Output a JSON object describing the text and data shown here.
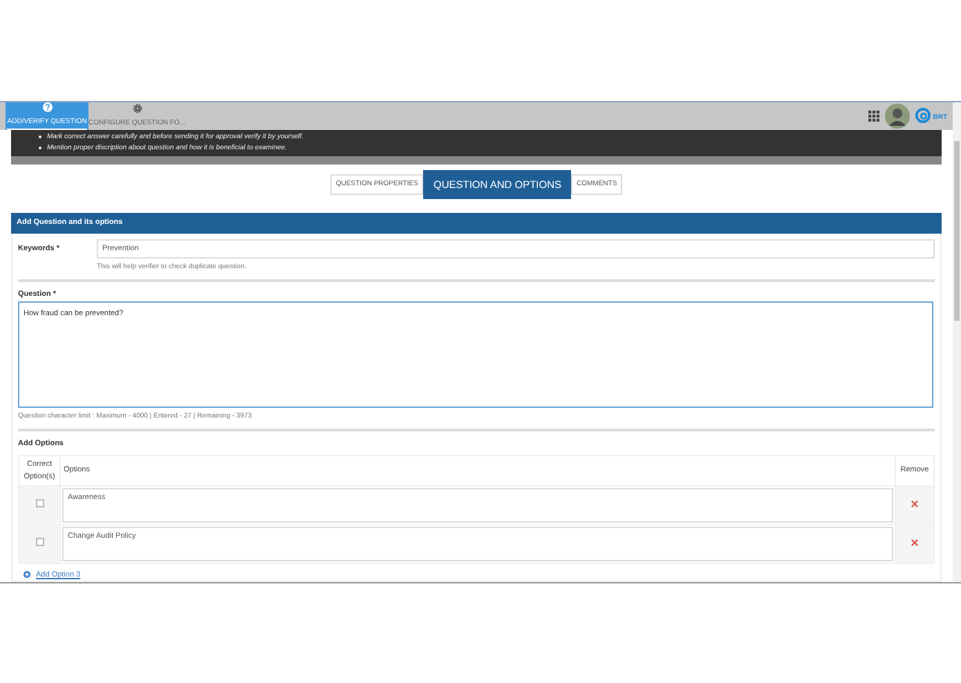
{
  "header_tabs": [
    {
      "label": "ADD/VERIFY QUESTION",
      "selected": true,
      "kind": "help"
    },
    {
      "label": "CONFIGURE QUESTION FO...",
      "selected": false,
      "kind": "gear"
    }
  ],
  "logo_text": "BRT",
  "instructions": [
    "Mark correct answer carefully and before sending it for approval verify it by yourself.",
    "Mention proper discription about question and how it is beneficial to examinee."
  ],
  "tabs": [
    {
      "label": "QUESTION PROPERTIES",
      "selected": false
    },
    {
      "label": "QUESTION AND OPTIONS",
      "selected": true
    },
    {
      "label": "COMMENTS",
      "selected": false
    }
  ],
  "panel": {
    "title": "Add Question and its options",
    "keywords": {
      "label": "Keywords *",
      "value": "Prevention",
      "hint": "This will help verifier to check duplicate question."
    },
    "question": {
      "label": "Question *",
      "value": "How fraud can be prevented?",
      "limit": "Question character limit : Maximum - 4000 | Entered - 27 | Remaining - 3973"
    },
    "options": {
      "title": "Add Options",
      "columns": [
        "Correct Option(s)",
        "Options",
        "Remove"
      ],
      "rows": [
        {
          "text": "Awareness",
          "checked": false
        },
        {
          "text": "Change Audit Policy",
          "checked": false
        }
      ],
      "add_link": "Add Option 3"
    }
  }
}
